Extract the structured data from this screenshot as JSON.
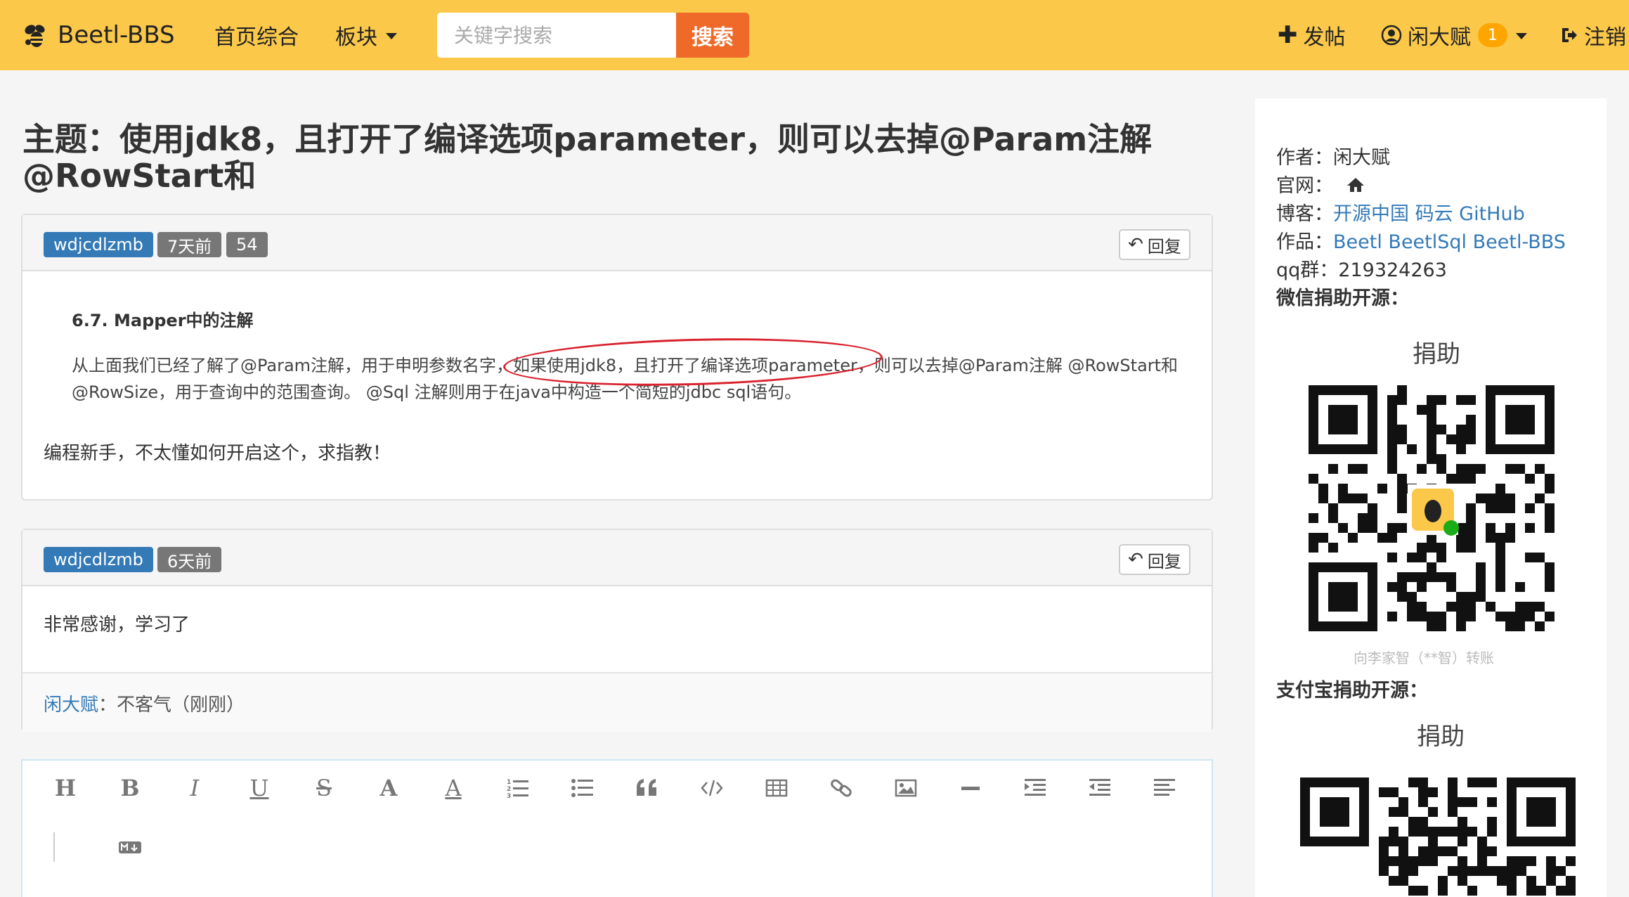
{
  "nav": {
    "brand": "Beetl-BBS",
    "home": "首页综合",
    "board": "板块",
    "search_placeholder": "关键字搜索",
    "search_button": "搜索",
    "post": "发帖",
    "user": "闲大赋",
    "notify_count": "1",
    "logout": "注销"
  },
  "topic": {
    "title": "主题：使用jdk8，且打开了编译选项parameter，则可以去掉@Param注解 @RowStart和"
  },
  "posts": [
    {
      "author": "wdjcdlzmb",
      "time": "7天前",
      "count": "54",
      "reply": "回复",
      "doc_heading": "6.7. Mapper中的注解",
      "doc_line1": "从上面我们已经了解了@Param注解，用于申明参数名字，如果使用jdk8，且打开了编译选项parameter，则可以去掉@Param注解 @RowStart和",
      "doc_line2": "@RowSize，用于查询中的范围查询。 @Sql 注解则用于在java中构造一个简短的jdbc sql语句。",
      "text": "编程新手，不太懂如何开启这个，求指教！"
    },
    {
      "author": "wdjcdlzmb",
      "time": "6天前",
      "reply": "回复",
      "text": "非常感谢，学习了",
      "comment_author": "闲大赋",
      "comment_text": "：不客气（刚刚）"
    }
  ],
  "sidebar": {
    "author_label": "作者：",
    "author_value": "闲大赋",
    "site_label": "官网：",
    "blog_label": "博客：",
    "blog_links": "开源中国 码云 GitHub",
    "works_label": "作品：",
    "works_links": "Beetl BeetlSql Beetl-BBS",
    "qq_label": "qq群：",
    "qq_value": "219324263",
    "wechat_label": "微信捐助开源：",
    "donate_title_1": "捐助",
    "qr_caption": "向李家智（**智）转账",
    "alipay_label": "支付宝捐助开源：",
    "donate_title_2": "捐助"
  },
  "colors": {
    "navbar": "#fbc84a",
    "search_button": "#ef6a28",
    "tag_blue": "#337ab7",
    "tag_gray": "#777777",
    "link": "#337ab7",
    "annotation_red": "#d9232e"
  }
}
